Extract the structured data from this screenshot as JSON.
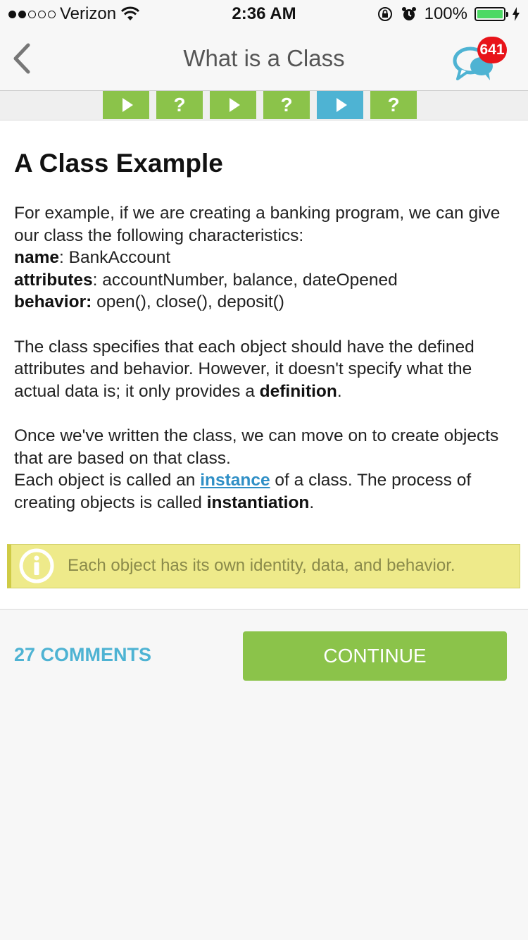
{
  "status_bar": {
    "carrier": "Verizon",
    "time": "2:36 AM",
    "battery": "100%",
    "battery_level": 1.0,
    "signal_bars": 2
  },
  "nav": {
    "title": "What is a Class",
    "badge_count": "641"
  },
  "steps": [
    {
      "kind": "play",
      "label": "",
      "active": false
    },
    {
      "kind": "quiz",
      "label": "?",
      "active": false
    },
    {
      "kind": "play",
      "label": "",
      "active": false
    },
    {
      "kind": "quiz",
      "label": "?",
      "active": false
    },
    {
      "kind": "play",
      "label": "",
      "active": true
    },
    {
      "kind": "quiz",
      "label": "?",
      "active": false
    }
  ],
  "lesson": {
    "heading": "A Class Example",
    "intro": "For example, if we are creating a banking program, we can give our class the following characteristics:",
    "name_label": "name",
    "name_value": ": BankAccount",
    "attributes_label": "attributes",
    "attributes_value": ": accountNumber, balance, dateOpened",
    "behavior_label": "behavior:",
    "behavior_value": " open(), close(), deposit()",
    "para2_a": "The class specifies that each object should have the defined attributes and behavior. However, it doesn't specify what the actual data is; it only provides a ",
    "para2_bold": "definition",
    "para2_b": ".",
    "para3_a": "Once we've written the class, we can move on to create objects that are based on that class.",
    "para3_b": "Each object is called an ",
    "para3_link": "instance",
    "para3_c": " of a class. The process of creating objects is called ",
    "para3_bold": "instantiation",
    "para3_d": "."
  },
  "note": {
    "text": "Each object has its own identity, data, and behavior.",
    "icon": "info-icon"
  },
  "footer": {
    "comments_label": "27 COMMENTS",
    "continue_label": "CONTINUE"
  },
  "colors": {
    "green": "#8bc34a",
    "blue": "#4eb3d3",
    "badge_red": "#e8141a",
    "note_yellow": "#eeea8a"
  }
}
